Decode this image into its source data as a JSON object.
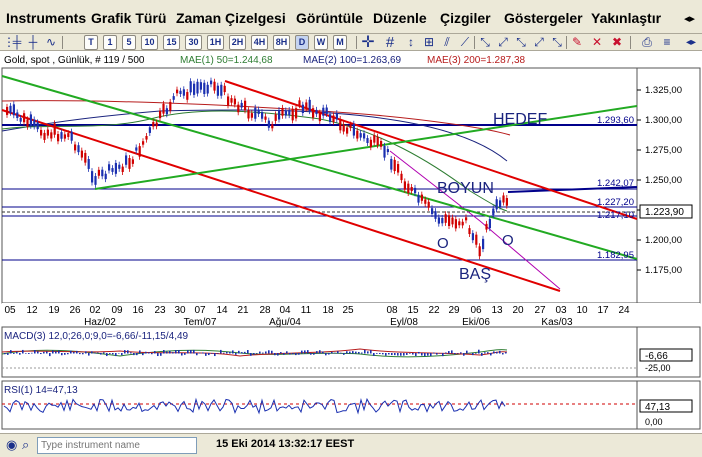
{
  "menu": [
    "Instruments",
    "Grafik Türü",
    "Zaman Çizelgesi",
    "Görüntüle",
    "Düzenle",
    "Çizgiler",
    "Göstergeler",
    "Yakınlaştır"
  ],
  "menu_scroll_icon": "chevron-left-right-icon",
  "toolbar": {
    "timeframes": [
      "T",
      "1",
      "5",
      "10",
      "15",
      "30",
      "1H",
      "2H",
      "4H",
      "8H",
      "D",
      "W",
      "M"
    ],
    "active_timeframe": "D"
  },
  "chart": {
    "header": "Gold, spot , Günlük, # 119 / 500",
    "mae1": "MAE(1) 50=1.244,68",
    "mae2": "MAE(2) 100=1.263,69",
    "mae3": "MAE(3) 200=1.287,38",
    "price_ticks": [
      "1.325,00",
      "1.300,00",
      "1.275,00",
      "1.250,00",
      "1.225,00",
      "1.200,00",
      "1.175,00"
    ],
    "level_labels": [
      "1.293,60",
      "1.242,07",
      "1.227,20",
      "1.217,10",
      "1.182,95"
    ],
    "last_price": "1.223,90",
    "date_ticks": [
      "05",
      "12",
      "19",
      "26",
      "02",
      "09",
      "16",
      "23",
      "30",
      "07",
      "14",
      "21",
      "28",
      "04",
      "11",
      "18",
      "25",
      "08",
      "15",
      "22",
      "29",
      "06",
      "13",
      "20",
      "27",
      "03",
      "10",
      "17",
      "24"
    ],
    "month_labels": [
      "Haz/02",
      "Tem/07",
      "Ağu/04",
      "Eyl/08",
      "Eki/06",
      "Kas/03"
    ],
    "annotations": {
      "target": "HEDEF",
      "neck": "BOYUN",
      "head": "BAŞ",
      "shoulder": "O"
    },
    "colors": {
      "channel": "#e00000",
      "trend": "#22aa22",
      "level": "#00008b",
      "candle_up": "#1a2fb0",
      "candle_down": "#d00000",
      "ma1": "#2e7d32",
      "ma2": "#1a237e",
      "ma3": "#b71c1c"
    }
  },
  "macd": {
    "label": "MACD(3) 12,0;26,0;9,0=-6,66/-11,15/4,49",
    "value": "-6,66",
    "tick": "-25,00"
  },
  "rsi": {
    "label": "RSI(1) 14=47,13",
    "value": "47,13",
    "tick_low": "0,00"
  },
  "status": {
    "search_placeholder": "Type instrument name",
    "timestamp": "15 Eki 2014 13:32:17 EEST"
  }
}
